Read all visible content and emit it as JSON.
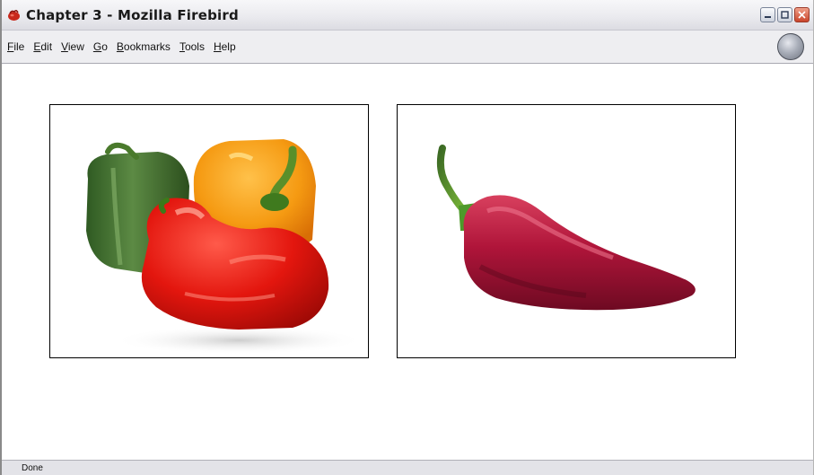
{
  "window": {
    "title": "Chapter 3 - Mozilla Firebird",
    "icon": "firebird-icon"
  },
  "menu": {
    "items": [
      {
        "label": "File",
        "access_key": "F",
        "rest": "ile"
      },
      {
        "label": "Edit",
        "access_key": "E",
        "rest": "dit"
      },
      {
        "label": "View",
        "access_key": "V",
        "rest": "iew"
      },
      {
        "label": "Go",
        "access_key": "G",
        "rest": "o"
      },
      {
        "label": "Bookmarks",
        "access_key": "B",
        "rest": "ookmarks"
      },
      {
        "label": "Tools",
        "access_key": "T",
        "rest": "ools"
      },
      {
        "label": "Help",
        "access_key": "H",
        "rest": "elp"
      }
    ]
  },
  "content": {
    "images": [
      {
        "subject": "bell peppers (green, orange, red)",
        "icon": "bell-peppers-image"
      },
      {
        "subject": "red chili pepper",
        "icon": "chili-pepper-image"
      }
    ]
  },
  "status": {
    "text": "Done"
  },
  "colors": {
    "titlebar": "#ebebef",
    "menubar": "#eeeef1",
    "statusbar": "#e3e3e8",
    "close_button": "#c9442a"
  }
}
